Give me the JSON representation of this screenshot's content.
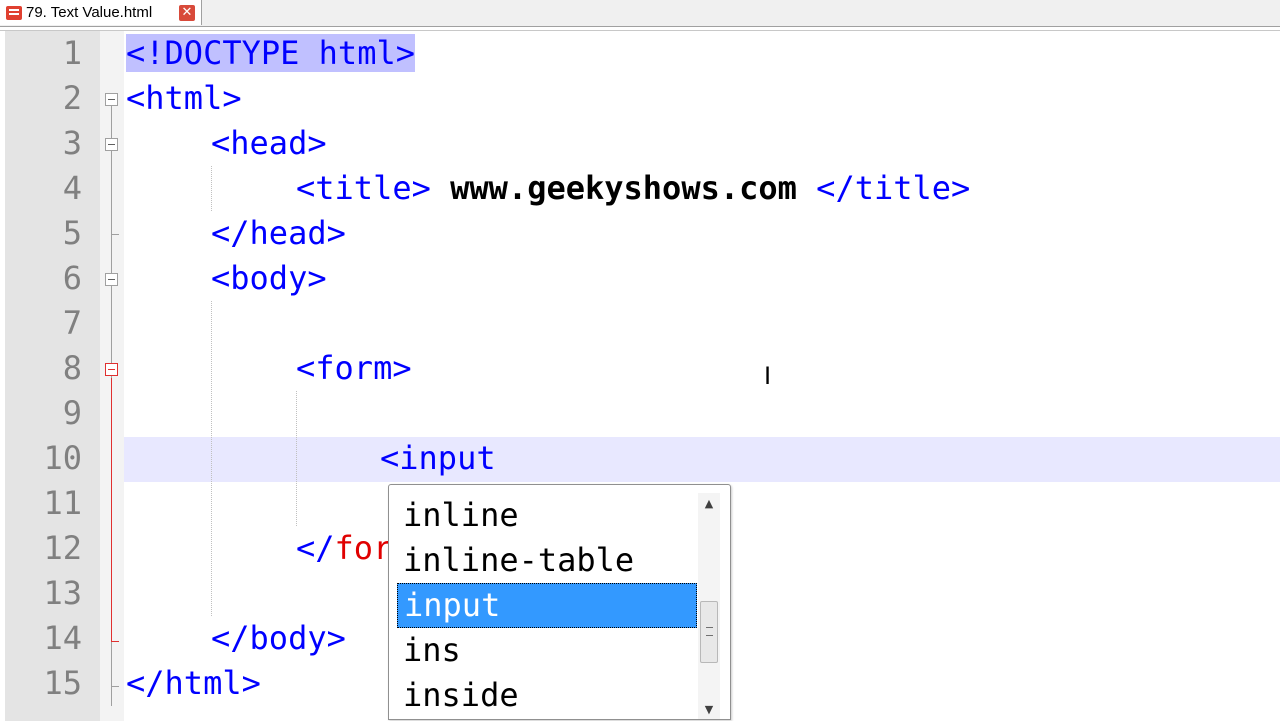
{
  "tab": {
    "label": "79. Text Value.html",
    "close_icon": "close-icon",
    "file_icon": "html-file-icon"
  },
  "lines": [
    {
      "num": "1",
      "code": "<!DOCTYPE html>"
    },
    {
      "num": "2",
      "code": "<html>"
    },
    {
      "num": "3",
      "code": "<head>"
    },
    {
      "num": "4",
      "code_open": "<title>",
      "code_text": " www.geekyshows.com ",
      "code_close": "</title>"
    },
    {
      "num": "5",
      "code": "</head>"
    },
    {
      "num": "6",
      "code": "<body>"
    },
    {
      "num": "7",
      "code": ""
    },
    {
      "num": "8",
      "code": "<form>"
    },
    {
      "num": "9",
      "code": ""
    },
    {
      "num": "10",
      "code": "<input"
    },
    {
      "num": "11",
      "code": ""
    },
    {
      "num": "12",
      "code_open": "</",
      "code_red": "for"
    },
    {
      "num": "13",
      "code": ""
    },
    {
      "num": "14",
      "code": "</body>"
    },
    {
      "num": "15",
      "code": "</html>"
    }
  ],
  "autocomplete": {
    "items": [
      "inline",
      "inline-table",
      "input",
      "ins",
      "inside"
    ],
    "selected": "input",
    "scroll_up_icon": "▲",
    "scroll_down_icon": "▼"
  },
  "cursor_icon": "I"
}
